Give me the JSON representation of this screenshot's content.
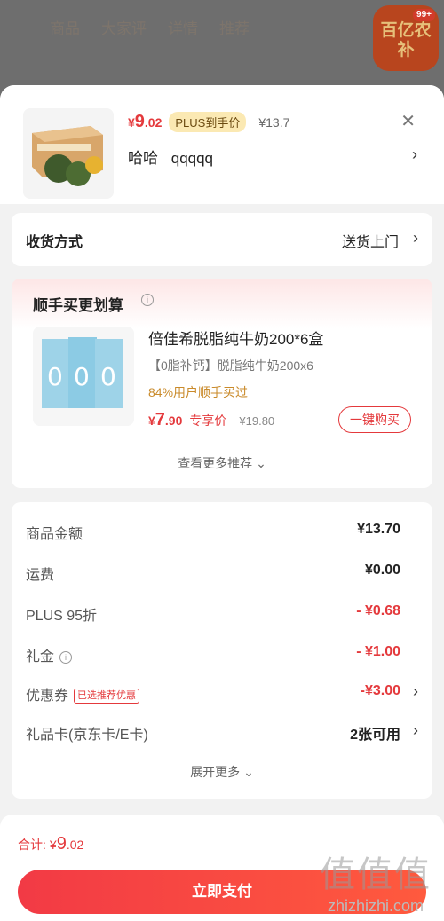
{
  "background": {
    "tabs": [
      "商品",
      "大家评",
      "详情",
      "推荐"
    ],
    "badge_text": "百亿农补",
    "badge_count": "99+"
  },
  "product": {
    "price_yen": "¥",
    "price_int": "9",
    "price_dec": ".02",
    "plus_tag": "PLUS到手价",
    "orig_price": "¥13.7",
    "spec": [
      "哈哈",
      "qqqqq"
    ]
  },
  "delivery": {
    "label": "收货方式",
    "value": "送货上门"
  },
  "recommend": {
    "title": "顺手买更划算",
    "name": "倍佳希脱脂纯牛奶200*6盒",
    "desc": "【0脂补钙】脱脂纯牛奶200x6",
    "percent": "84%用户顺手买过",
    "price_yen": "¥",
    "price_int": "7",
    "price_dec": ".90",
    "exclusive": "专享价",
    "orig_price": "¥19.80",
    "buy_label": "一键购买",
    "more_label": "查看更多推荐"
  },
  "summary": {
    "rows": [
      {
        "label": "商品金额",
        "value": "¥13.70"
      },
      {
        "label": "运费",
        "value": "¥0.00"
      },
      {
        "label": "PLUS 95折",
        "value": "- ¥0.68"
      },
      {
        "label": "礼金",
        "value": "- ¥1.00"
      },
      {
        "label": "优惠券",
        "tag": "已选推荐优惠",
        "value": "-¥3.00"
      },
      {
        "label": "礼品卡(京东卡/E卡)",
        "value": "2张可用"
      }
    ],
    "more_label": "展开更多"
  },
  "footer": {
    "total_label": "合计:",
    "total_yen": "¥",
    "total_int": "9",
    "total_dec": ".02",
    "pay_label": "立即支付"
  },
  "watermark": {
    "brand": "值值值",
    "url": "zhizhizhi.com"
  },
  "colors": {
    "accent": "#e4393c",
    "plus_tag_bg": "#fbe9b3",
    "sheet_bg": "#f2f2f2"
  }
}
